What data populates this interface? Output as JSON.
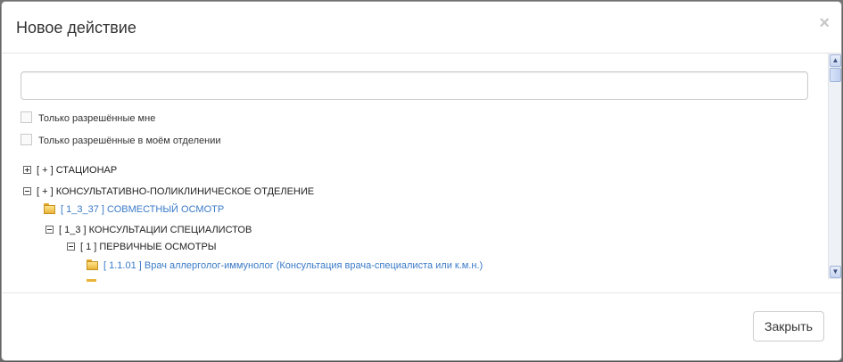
{
  "modal": {
    "title": "Новое действие",
    "close_glyph": "×"
  },
  "search": {
    "value": "",
    "placeholder": ""
  },
  "filters": [
    {
      "label": "Только разрешённые мне",
      "checked": false
    },
    {
      "label": "Только разрешённые в моём отделении",
      "checked": false
    }
  ],
  "tree": [
    {
      "expander": "plus",
      "text": "[ + ] СТАЦИОНАР"
    },
    {
      "expander": "minus",
      "text": "[ + ] КОНСУЛЬТАТИВНО-ПОЛИКЛИНИЧЕСКОЕ ОТДЕЛЕНИЕ"
    },
    {
      "icon": "folder-icon",
      "text": "[ 1_3_37 ] СОВМЕСТНЫЙ ОСМОТР"
    },
    {
      "expander": "minus",
      "text": "[ 1_3 ] КОНСУЛЬТАЦИИ СПЕЦИАЛИСТОВ"
    },
    {
      "expander": "minus",
      "text": "[ 1 ] ПЕРВИЧНЫЕ ОСМОТРЫ"
    },
    {
      "icon": "folder-icon",
      "text": "[ 1.1.01 ] Врач аллерголог-иммунолог (Консультация врача-специалиста или к.м.н.)"
    }
  ],
  "scrollbar": {
    "up_glyph": "▲",
    "down_glyph": "▼"
  },
  "footer": {
    "close_label": "Закрыть"
  },
  "colors": {
    "link": "#3a7bc8",
    "folder": "#e9b43a"
  }
}
